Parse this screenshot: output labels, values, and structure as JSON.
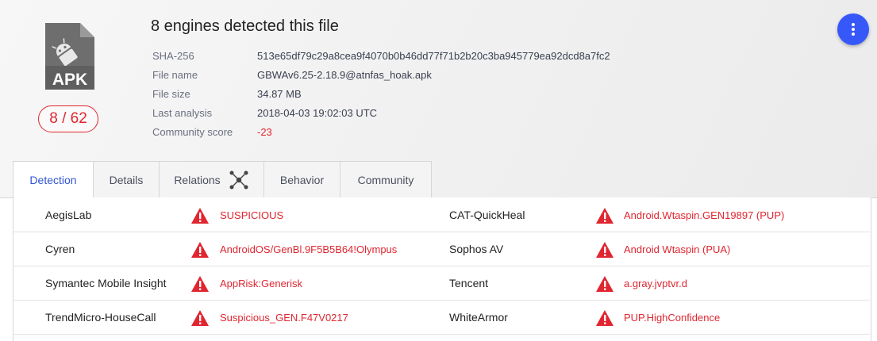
{
  "file": {
    "type_label": "APK",
    "detection_ratio": "8 / 62",
    "title": "8 engines detected this file"
  },
  "meta": [
    {
      "key": "SHA-256",
      "value": "513e65df79c29a8cea9f4070b0b46dd77f71b2b20c3ba945779ea92dcd8a7fc2"
    },
    {
      "key": "File name",
      "value": "GBWAv6.25-2.18.9@atnfas_hoak.apk"
    },
    {
      "key": "File size",
      "value": "34.87 MB"
    },
    {
      "key": "Last analysis",
      "value": "2018-04-03 19:02:03 UTC"
    },
    {
      "key": "Community score",
      "value": "-23"
    }
  ],
  "tabs": [
    {
      "label": "Detection",
      "active": true
    },
    {
      "label": "Details"
    },
    {
      "label": "Relations",
      "icon": "graph-network-icon"
    },
    {
      "label": "Behavior"
    },
    {
      "label": "Community"
    }
  ],
  "detections": [
    [
      {
        "engine": "AegisLab",
        "result": "SUSPICIOUS"
      },
      {
        "engine": "CAT-QuickHeal",
        "result": "Android.Wtaspin.GEN19897 (PUP)"
      }
    ],
    [
      {
        "engine": "Cyren",
        "result": "AndroidOS/GenBl.9F5B5B64!Olympus"
      },
      {
        "engine": "Sophos AV",
        "result": "Android Wtaspin (PUA)"
      }
    ],
    [
      {
        "engine": "Symantec Mobile Insight",
        "result": "AppRisk:Generisk"
      },
      {
        "engine": "Tencent",
        "result": "a.gray.jvptvr.d"
      }
    ],
    [
      {
        "engine": "TrendMicro-HouseCall",
        "result": "Suspicious_GEN.F47V0217"
      },
      {
        "engine": "WhiteArmor",
        "result": "PUP.HighConfidence"
      }
    ]
  ],
  "icons": {
    "file": "apk-file-icon",
    "more": "more-vert-icon",
    "warning": "warning-triangle-icon"
  },
  "colors": {
    "accent": "#3758f9",
    "malicious": "#e02630",
    "active_tab_text": "#3255d6"
  }
}
